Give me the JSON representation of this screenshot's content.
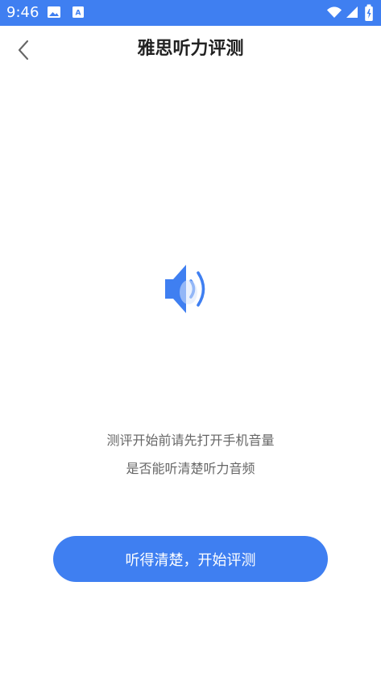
{
  "status_bar": {
    "time": "9:46",
    "left_icons": [
      "image-icon",
      "text-app-icon"
    ],
    "right_icons": [
      "wifi-icon",
      "signal-icon",
      "battery-icon"
    ],
    "background": "#3f7ff1",
    "foreground": "#ffffff"
  },
  "header": {
    "title": "雅思听力评测",
    "back_icon": "chevron-left-icon"
  },
  "main": {
    "icon": "speaker-icon",
    "instruction_line1": "测评开始前请先打开手机音量",
    "instruction_line2": "是否能听清楚听力音频"
  },
  "actions": {
    "start_label": "听得清楚，开始评测",
    "accent": "#3f7ff1"
  }
}
